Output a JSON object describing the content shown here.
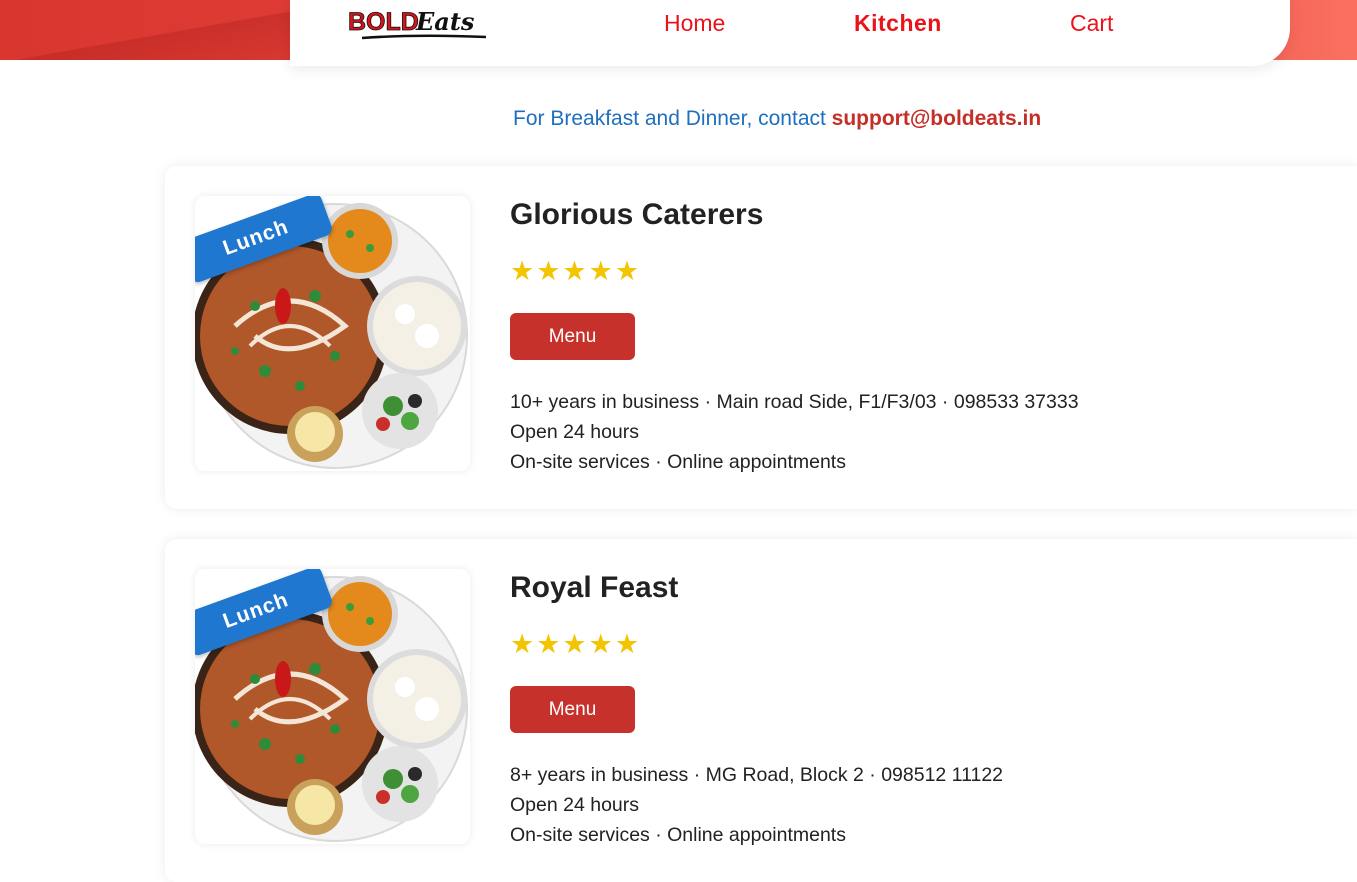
{
  "brand": {
    "logo_text_bold": "BOLD",
    "logo_text_script": "Eats",
    "color_primary": "#e8141c",
    "color_button": "#c7312b",
    "color_link_blue": "#1f6fbf"
  },
  "nav": {
    "home": "Home",
    "kitchen": "Kitchen",
    "cart": "Cart",
    "active": "Kitchen"
  },
  "contact": {
    "text": "For Breakfast and Dinner, contact",
    "email": "support@boldeats.in"
  },
  "kitchens": [
    {
      "ribbon": "Lunch",
      "name": "Glorious Caterers",
      "stars": "★★★★★",
      "rating": 5,
      "menu_label": "Menu",
      "details_line1": "10+ years in business · Main road Side, F1/F3/03 · 098533 37333",
      "details_line2": "Open 24 hours",
      "details_line3": "On-site services · Online appointments"
    },
    {
      "ribbon": "Lunch",
      "name": "Royal Feast",
      "stars": "★★★★★",
      "rating": 5,
      "menu_label": "Menu",
      "details_line1": "8+ years in business · MG Road, Block 2 · 098512 11122",
      "details_line2": "Open 24 hours",
      "details_line3": "On-site services · Online appointments"
    }
  ],
  "icons": {
    "thali_image": "thali-plate-image",
    "star": "star-icon"
  }
}
